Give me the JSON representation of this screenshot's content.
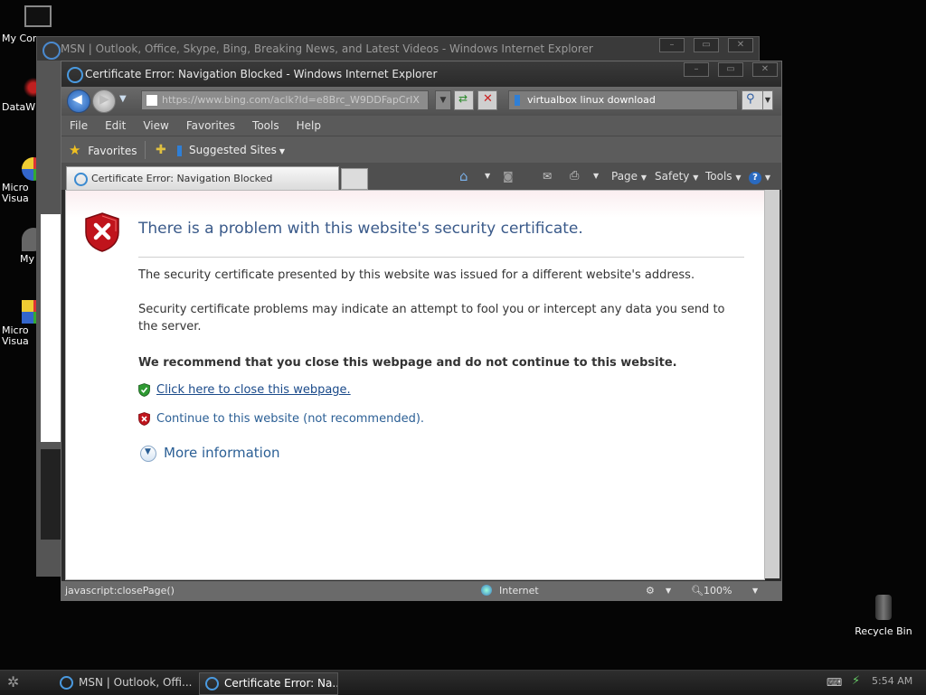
{
  "desktop": {
    "icons": [
      {
        "label": "My Com",
        "icon": "monitor-icon"
      },
      {
        "label": "DataW",
        "icon": "app-icon"
      },
      {
        "label": "Micro Visua",
        "icon": "visual-studio-icon"
      },
      {
        "label": "My",
        "icon": "music-icon"
      },
      {
        "label": "Micro Visua",
        "icon": "visual-studio-icon"
      }
    ],
    "recycle_bin": "Recycle Bin"
  },
  "back_window": {
    "title": "MSN | Outlook, Office, Skype, Bing, Breaking News, and Latest Videos - Windows Internet Explorer"
  },
  "window": {
    "title": "Certificate Error: Navigation Blocked - Windows Internet Explorer",
    "address": "https://www.bing.com/aclk?ld=e8Brc_W9DDFapCrIX",
    "search_value": "virtualbox linux download",
    "menu": [
      "File",
      "Edit",
      "View",
      "Favorites",
      "Tools",
      "Help"
    ],
    "favorites_label": "Favorites",
    "suggested_sites": "Suggested Sites",
    "tab_label": "Certificate Error: Navigation Blocked",
    "commands": {
      "page": "Page",
      "safety": "Safety",
      "tools": "Tools"
    },
    "status": {
      "url": "javascript:closePage()",
      "zone": "Internet",
      "zoom": "100%"
    }
  },
  "error_page": {
    "title": "There is a problem with this website's security certificate.",
    "para1": "The security certificate presented by this website was issued for a different website's address.",
    "para2": "Security certificate problems may indicate an attempt to fool you or intercept any data you send to the server.",
    "recommend": "We recommend that you close this webpage and do not continue to this website.",
    "close_link": "Click here to close this webpage.",
    "continue_link": "Continue to this website (not recommended).",
    "more_info": "More information"
  },
  "taskbar": {
    "tasks": [
      "MSN | Outlook, Offi...",
      "Certificate Error: Na..."
    ],
    "clock": "5:54 AM"
  }
}
